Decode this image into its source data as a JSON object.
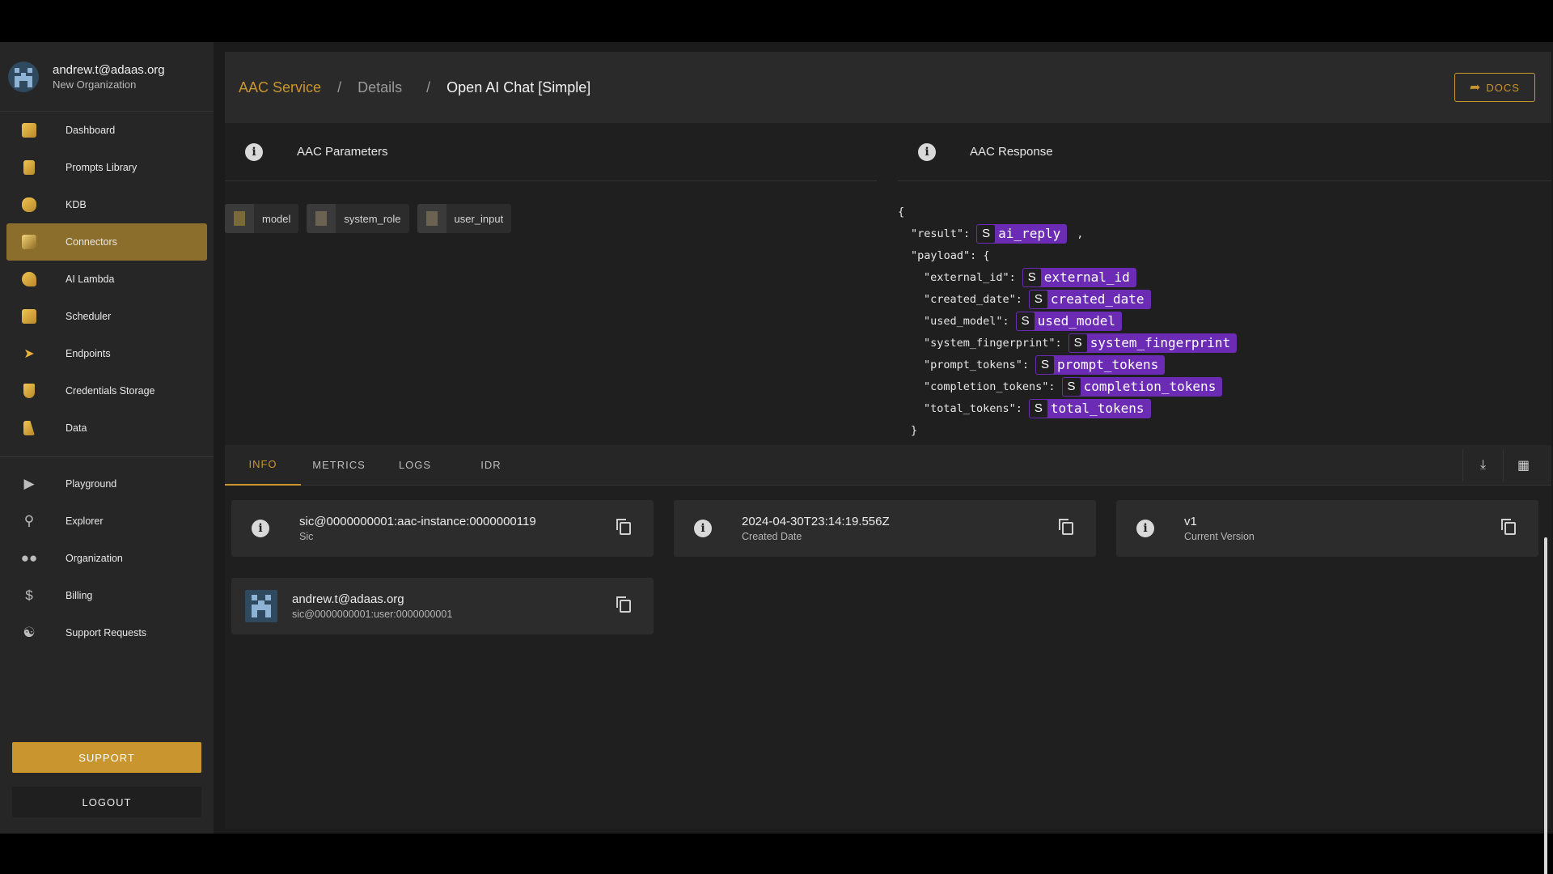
{
  "user": {
    "email": "andrew.t@adaas.org",
    "org": "New Organization"
  },
  "nav": {
    "items": [
      {
        "label": "Dashboard",
        "icon": "dashboard-icon"
      },
      {
        "label": "Prompts Library",
        "icon": "prompts-library-icon"
      },
      {
        "label": "KDB",
        "icon": "database-icon"
      },
      {
        "label": "Connectors",
        "icon": "connectors-icon",
        "active": true
      },
      {
        "label": "AI Lambda",
        "icon": "lambda-icon"
      },
      {
        "label": "Scheduler",
        "icon": "scheduler-icon"
      },
      {
        "label": "Endpoints",
        "icon": "paper-plane-icon"
      },
      {
        "label": "Credentials Storage",
        "icon": "shield-icon"
      },
      {
        "label": "Data",
        "icon": "data-icon"
      }
    ],
    "secondary": [
      {
        "label": "Playground",
        "icon": "play-icon"
      },
      {
        "label": "Explorer",
        "icon": "search-icon"
      },
      {
        "label": "Organization",
        "icon": "people-icon"
      },
      {
        "label": "Billing",
        "icon": "dollar-icon"
      },
      {
        "label": "Support Requests",
        "icon": "support-icon"
      }
    ],
    "support_label": "SUPPORT",
    "logout_label": "LOGOUT"
  },
  "breadcrumb": {
    "service": "AAC Service",
    "details": "Details",
    "current": "Open AI Chat [Simple]",
    "sep": "/"
  },
  "docs_label": "DOCS",
  "parameters": {
    "title": "AAC Parameters",
    "chips": [
      "model",
      "system_role",
      "user_input"
    ]
  },
  "response": {
    "title": "AAC Response",
    "open_brace": "{",
    "close_brace": "}",
    "result_key": "\"result\":",
    "result_val": "ai_reply",
    "result_comma": ",",
    "payload_key": "\"payload\": {",
    "fields": [
      {
        "key": "\"external_id\":",
        "val": "external_id"
      },
      {
        "key": "\"created_date\":",
        "val": "created_date"
      },
      {
        "key": "\"used_model\":",
        "val": "used_model"
      },
      {
        "key": "\"system_fingerprint\":",
        "val": "system_fingerprint"
      },
      {
        "key": "\"prompt_tokens\":",
        "val": "prompt_tokens"
      },
      {
        "key": "\"completion_tokens\":",
        "val": "completion_tokens"
      },
      {
        "key": "\"total_tokens\":",
        "val": "total_tokens"
      }
    ],
    "type_letter": "S"
  },
  "tabs": [
    "INFO",
    "METRICS",
    "LOGS",
    "IDR"
  ],
  "cards": {
    "sic": {
      "value": "sic@0000000001:aac-instance:0000000119",
      "label": "Sic"
    },
    "created": {
      "value": "2024-04-30T23:14:19.556Z",
      "label": "Created Date"
    },
    "version": {
      "value": "v1",
      "label": "Current Version"
    },
    "owner": {
      "value": "andrew.t@adaas.org",
      "label": "sic@0000000001:user:0000000001"
    }
  },
  "colors": {
    "accent": "#c9952e",
    "tag": "#6c2bb5",
    "active_nav": "#8b6d2c"
  }
}
